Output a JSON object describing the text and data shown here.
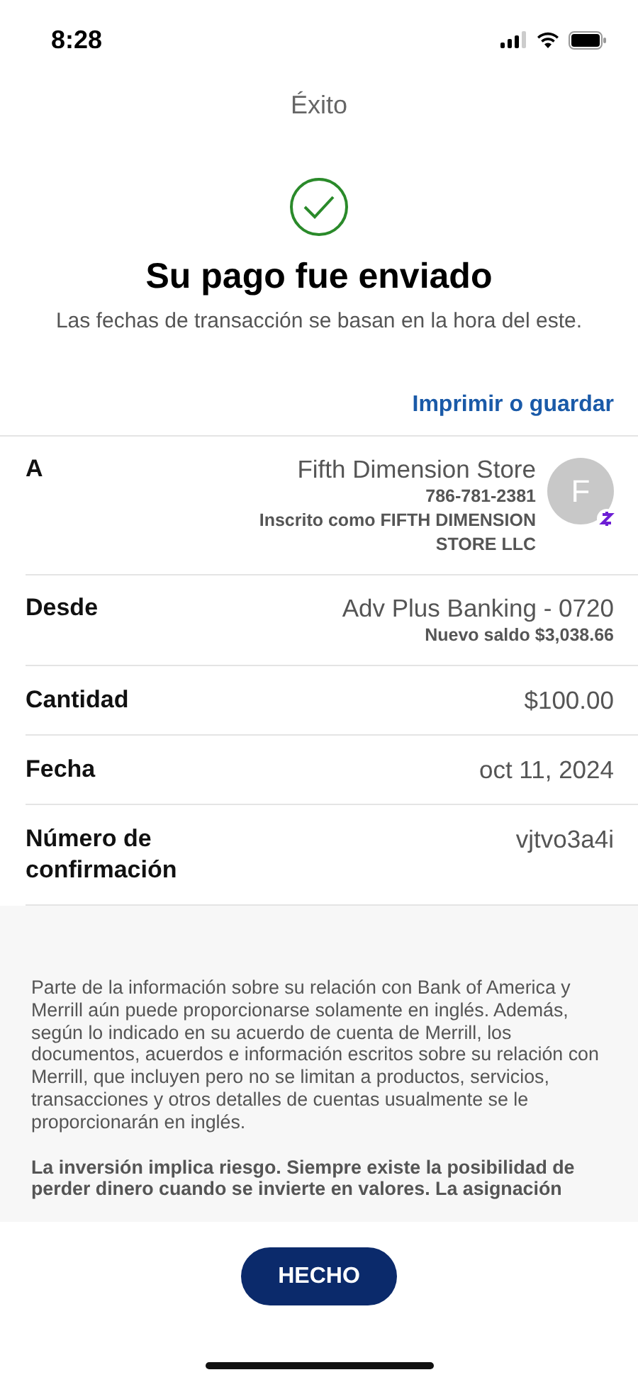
{
  "status_bar": {
    "time": "8:28"
  },
  "header": {
    "title": "Éxito",
    "heading": "Su pago fue enviado",
    "subtitle": "Las fechas de transacción se basan en la hora del este.",
    "link": "Imprimir o guardar"
  },
  "details": [
    {
      "kind": "payee",
      "label": "A",
      "value": "Fifth Dimension Store",
      "notes": [
        "786-781-2381",
        "Inscrito como FIFTH DIMENSION STORE LLC"
      ],
      "avatar": "F"
    },
    {
      "kind": "plain",
      "label": "Desde",
      "value": "Adv Plus Banking - 0720",
      "notes": [
        "Nuevo saldo $3,038.66"
      ]
    },
    {
      "kind": "plain",
      "label": "Cantidad",
      "value": "$100.00"
    },
    {
      "kind": "plain",
      "label": "Fecha",
      "value": "oct 11, 2024"
    },
    {
      "kind": "plain",
      "label": "Número de confirmación",
      "value": "vjtvo3a4i"
    }
  ],
  "disclaimer": [
    {
      "kind": "normal",
      "text": "Parte de la información sobre su relación con Bank of America y Merrill aún puede proporcionarse solamente en inglés. Además, según lo indicado en su acuerdo de cuenta de Merrill, los documentos, acuerdos e información escritos sobre su relación con Merrill, que incluyen pero no se limitan a productos, servicios, transacciones y otros detalles de cuentas usualmente se le proporcionarán en inglés."
    },
    {
      "kind": "emphasis",
      "text": "La inversión implica riesgo. Siempre existe la posibilidad de perder dinero cuando se invierte en valores. La asignación"
    }
  ],
  "done_button": "HECHO"
}
